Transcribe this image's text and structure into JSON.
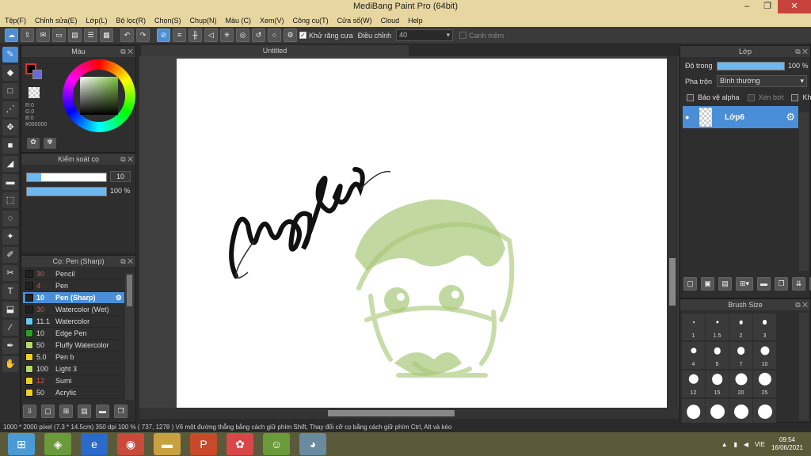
{
  "window": {
    "title": "MediBang Paint Pro (64bit)",
    "minimize": "‒",
    "maximize": "❐",
    "close": "✕"
  },
  "menu": [
    "Tệp(F)",
    "Chỉnh sửa(E)",
    "Lớp(L)",
    "Bộ lọc(R)",
    "Chọn(S)",
    "Chụp(N)",
    "Màu (C)",
    "Xem(V)",
    "Công cụ(T)",
    "Cửa số(W)",
    "Cloud",
    "Help"
  ],
  "toolbar": {
    "antialias_label": "Khử răng cưa",
    "adjust_label": "Điều chỉnh",
    "adjust_value": "40",
    "snap_label": "Canh mêm"
  },
  "color_panel": {
    "title": "Màu",
    "r": "R:0",
    "g": "G:0",
    "b": "B:0",
    "hex": "#000000"
  },
  "brush_control": {
    "title": "Kiểm soát cọ",
    "size": "10",
    "opacity": "100 %",
    "opacity_fill": 1.0
  },
  "brush_list": {
    "title": "Cọ: Pen (Sharp)",
    "items": [
      {
        "size": "30",
        "name": "Pencil",
        "color": "#222222",
        "size_color": "#e05050"
      },
      {
        "size": "4",
        "name": "Pen",
        "color": "#222222",
        "size_color": "#e05050"
      },
      {
        "size": "10",
        "name": "Pen (Sharp)",
        "color": "#222222",
        "size_color": "#ffffff"
      },
      {
        "size": "30",
        "name": "Watercolor (Wet)",
        "color": "#222222",
        "size_color": "#e05050"
      },
      {
        "size": "11.1",
        "name": "Watercolor",
        "color": "#6ac8f0",
        "size_color": "#dddddd"
      },
      {
        "size": "10",
        "name": "Edge Pen",
        "color": "#2aa02a",
        "size_color": "#dddddd"
      },
      {
        "size": "50",
        "name": "Fluffy Watercolor",
        "color": "#b8d86a",
        "size_color": "#dddddd"
      },
      {
        "size": "5.0",
        "name": " Pen b",
        "color": "#f0d020",
        "size_color": "#dddddd"
      },
      {
        "size": "100",
        "name": "Light 3",
        "color": "#b8d86a",
        "size_color": "#dddddd"
      },
      {
        "size": "12",
        "name": "Sumi",
        "color": "#f0d020",
        "size_color": "#e05050"
      },
      {
        "size": "50",
        "name": "Acrylic",
        "color": "#f0d020",
        "size_color": "#dddddd"
      }
    ]
  },
  "document": {
    "tab": "Untitled"
  },
  "layer_panel": {
    "title": "Lớp",
    "opacity_label": "Độ trong",
    "opacity_value": "100 %",
    "opacity_fill": 1.0,
    "blend_label": "Pha trộn",
    "blend_value": "Bình thường",
    "protect_alpha": "Bảo vệ alpha",
    "clipping": "Xén bớt",
    "lock": "Khóa",
    "layer_name": "Lớp6"
  },
  "brush_size": {
    "title": "Brush Size",
    "sizes": [
      "1",
      "1.5",
      "2",
      "3",
      "4",
      "5",
      "7",
      "10",
      "12",
      "15",
      "20",
      "25",
      "",
      "",
      "",
      ""
    ]
  },
  "status": {
    "text": "1000 * 2000 pixel   (7.3 * 14.5cm)   350 dpi   100 %   ( 737, 1278 )   Vẽ một đường thẳng bằng cách giữ phím Shift, Thay đổi cỡ cọ bằng cách giữ phím Ctrl, Alt và kéo"
  },
  "taskbar": {
    "lang": "VIE",
    "time": "09:54",
    "date": "16/06/2021"
  }
}
